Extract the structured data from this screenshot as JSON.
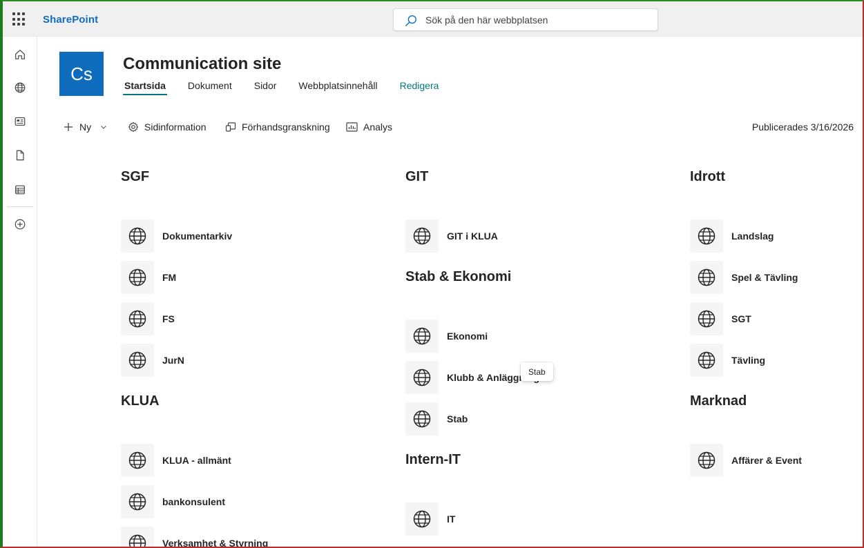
{
  "suite": {
    "brand": "SharePoint",
    "search_placeholder": "Sök på den här webbplatsen"
  },
  "appbar": {
    "items": [
      {
        "icon": "home-icon"
      },
      {
        "icon": "globe-icon"
      },
      {
        "icon": "news-icon"
      },
      {
        "icon": "file-icon"
      },
      {
        "icon": "list-icon"
      },
      {
        "icon": "add-circle-icon"
      }
    ]
  },
  "site": {
    "logo_text": "Cs",
    "title": "Communication site",
    "nav": [
      "Startsida",
      "Dokument",
      "Sidor",
      "Webbplatsinnehåll",
      "Redigera"
    ]
  },
  "commands": {
    "new": "Ny",
    "page_details": "Sidinformation",
    "preview": "Förhandsgranskning",
    "analytics": "Analys",
    "published": "Publicerades 3/16/2026"
  },
  "sections": {
    "sgf": {
      "title": "SGF",
      "links": [
        "Dokumentarkiv",
        "FM",
        "FS",
        "JurN"
      ]
    },
    "klua": {
      "title": "KLUA",
      "links": [
        "KLUA - allmänt",
        "bankonsulent",
        "Verksamhet & Styrning"
      ]
    },
    "git": {
      "title": "GIT",
      "links": [
        "GIT i KLUA"
      ]
    },
    "stab": {
      "title": "Stab & Ekonomi",
      "links": [
        "Ekonomi",
        "Klubb & Anläggning",
        "Stab"
      ]
    },
    "internit": {
      "title": "Intern-IT",
      "links": [
        "IT"
      ]
    },
    "idrott": {
      "title": "Idrott",
      "links": [
        "Landslag",
        "Spel & Tävling",
        "SGT",
        "Tävling"
      ]
    },
    "marknad": {
      "title": "Marknad",
      "links": [
        "Affärer & Event"
      ]
    }
  },
  "tooltip": "Stab",
  "colors": {
    "brand_blue": "#0f6cbd",
    "accent_teal": "#03787c",
    "suitebar_bg": "#f0f0f0",
    "tile_bg": "#f5f5f5"
  }
}
